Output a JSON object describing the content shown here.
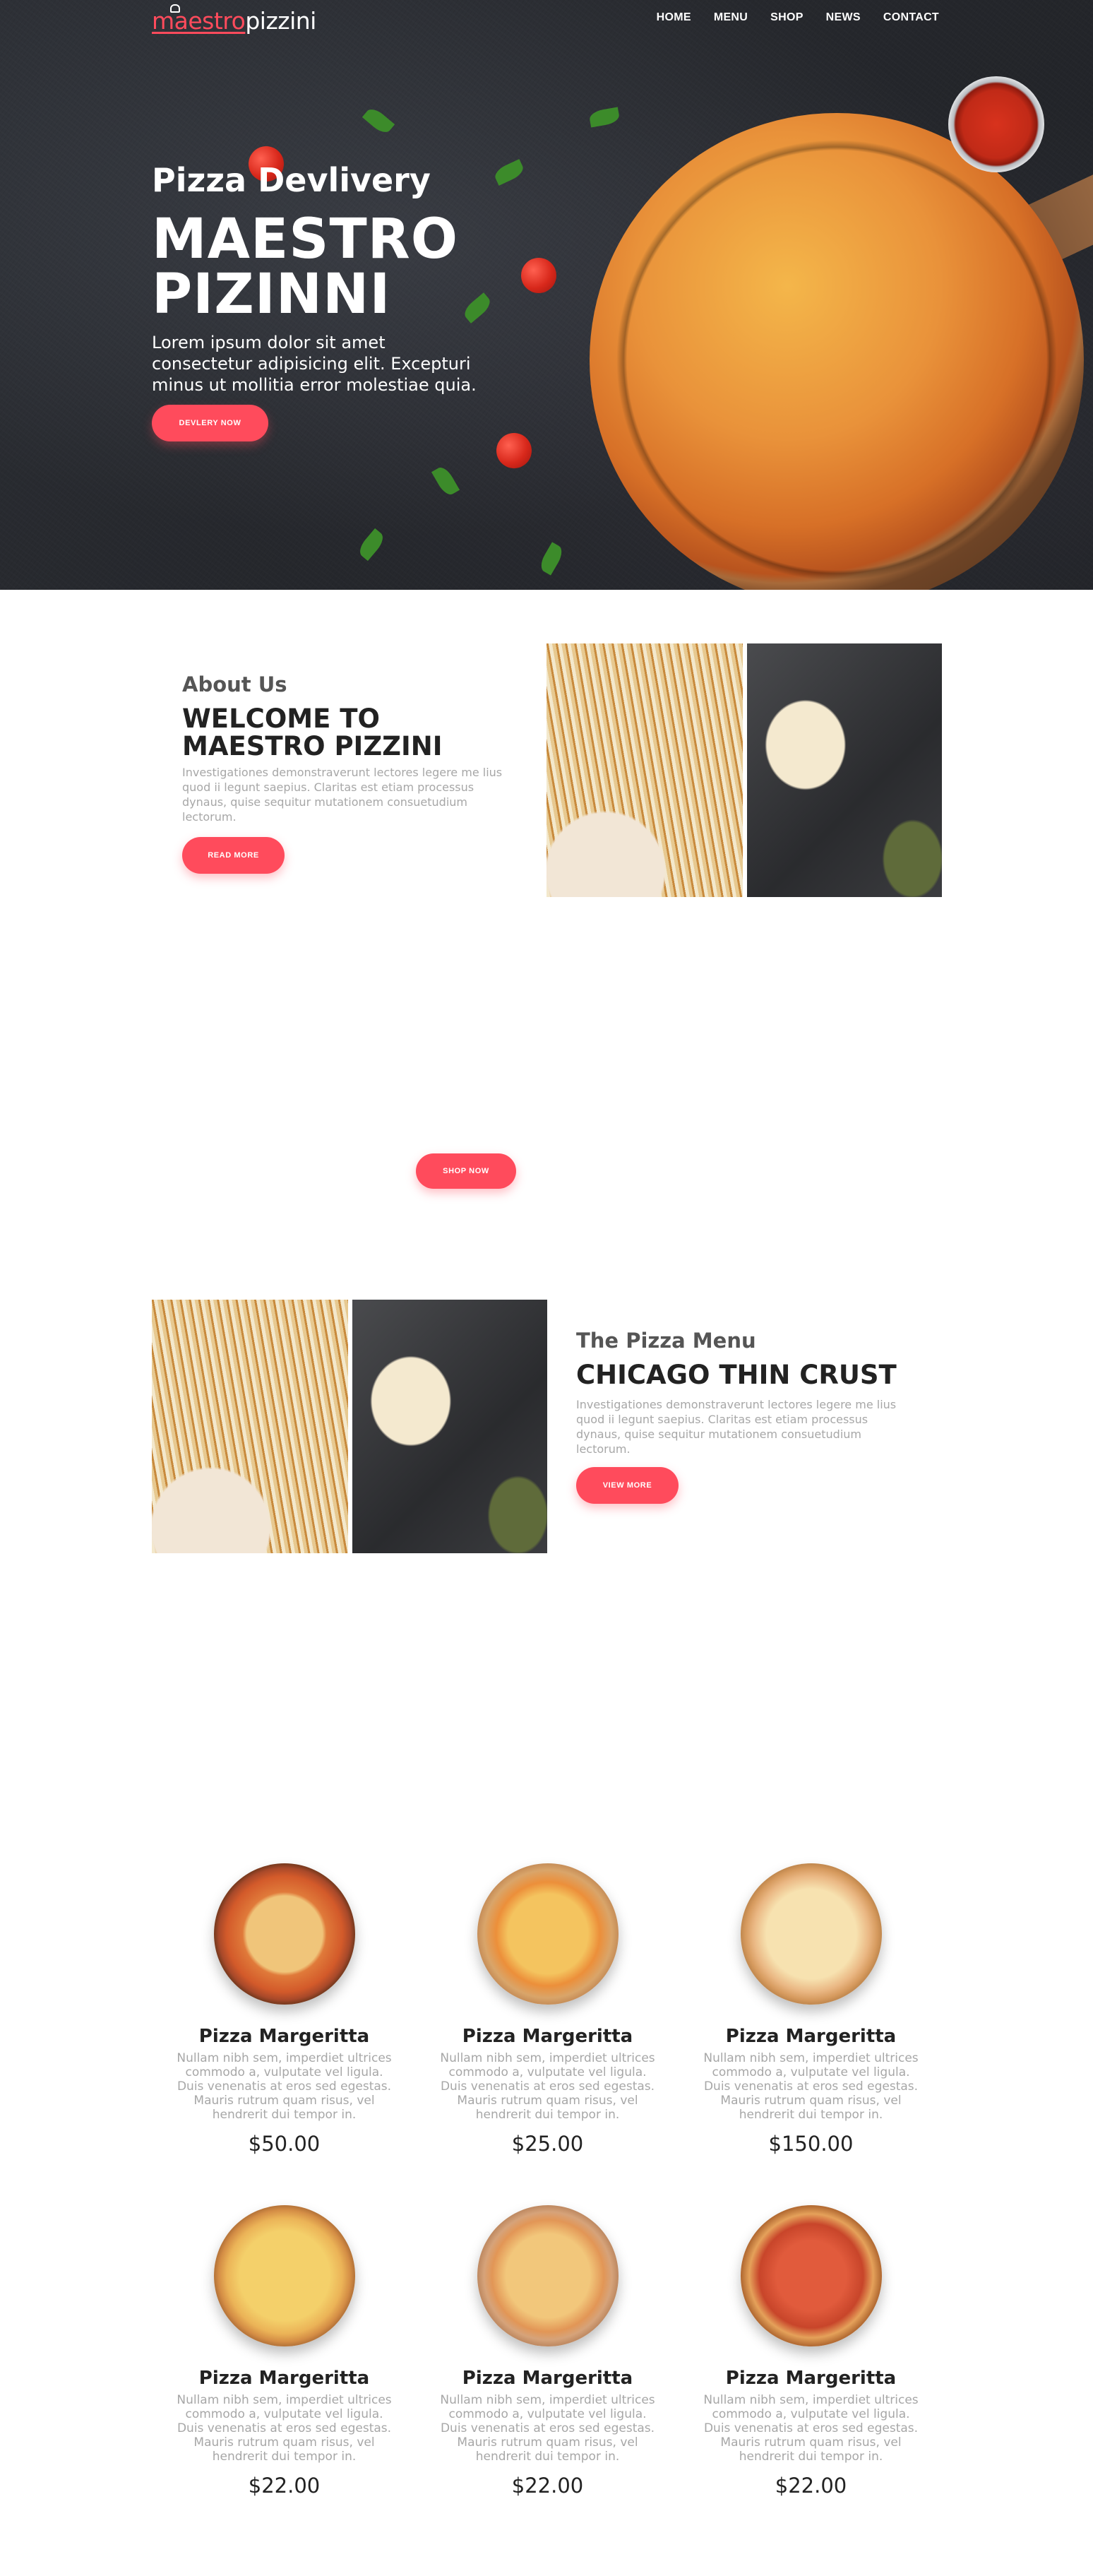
{
  "brand": {
    "logo_part1": "maestro",
    "logo_part2": "pizzini",
    "accent": "#ff4b5c"
  },
  "nav": {
    "items": [
      "HOME",
      "MENU",
      "SHOP",
      "NEWS",
      "CONTACT"
    ]
  },
  "hero": {
    "subtitle": "Pizza Devlivery",
    "title_line1": "MAESTRO",
    "title_line2": "PIZINNI",
    "text": "Lorem ipsum dolor sit amet consectetur adipisicing elit. Excepturi minus ut mollitia error molestiae quia.",
    "button": "DEVLERY NOW"
  },
  "about": {
    "kicker": "About Us",
    "title_line1": "WELCOME TO",
    "title_line2": "MAESTRO PIZZINI",
    "text": "Investigationes demonstraverunt lectores legere me lius quod ii legunt saepius. Claritas est etiam processus dynaus, quise sequitur mutationem consuetudium lectorum.",
    "button": "READ MORE"
  },
  "shop": {
    "button": "SHOP NOW"
  },
  "menu": {
    "kicker": "The Pizza Menu",
    "title": "CHICAGO THIN CRUST",
    "text": "Investigationes demonstraverunt lectores legere me lius quod ii legunt saepius. Claritas est etiam processus dynaus, quise sequitur mutationem consuetudium lectorum.",
    "button": "VIEW MORE"
  },
  "products": [
    {
      "name": "Pizza Margeritta",
      "desc": "Nullam nibh sem, imperdiet ultrices commodo a, vulputate vel ligula. Duis venenatis at eros sed egestas. Mauris rutrum quam risus, vel hendrerit dui tempor in.",
      "price": "$50.00"
    },
    {
      "name": "Pizza Margeritta",
      "desc": "Nullam nibh sem, imperdiet ultrices commodo a, vulputate vel ligula. Duis venenatis at eros sed egestas. Mauris rutrum quam risus, vel hendrerit dui tempor in.",
      "price": "$25.00"
    },
    {
      "name": "Pizza Margeritta",
      "desc": "Nullam nibh sem, imperdiet ultrices commodo a, vulputate vel ligula. Duis venenatis at eros sed egestas. Mauris rutrum quam risus, vel hendrerit dui tempor in.",
      "price": "$150.00"
    },
    {
      "name": "Pizza Margeritta",
      "desc": "Nullam nibh sem, imperdiet ultrices commodo a, vulputate vel ligula. Duis venenatis at eros sed egestas. Mauris rutrum quam risus, vel hendrerit dui tempor in.",
      "price": "$22.00"
    },
    {
      "name": "Pizza Margeritta",
      "desc": "Nullam nibh sem, imperdiet ultrices commodo a, vulputate vel ligula. Duis venenatis at eros sed egestas. Mauris rutrum quam risus, vel hendrerit dui tempor in.",
      "price": "$22.00"
    },
    {
      "name": "Pizza Margeritta",
      "desc": "Nullam nibh sem, imperdiet ultrices commodo a, vulputate vel ligula. Duis venenatis at eros sed egestas. Mauris rutrum quam risus, vel hendrerit dui tempor in.",
      "price": "$22.00"
    }
  ]
}
